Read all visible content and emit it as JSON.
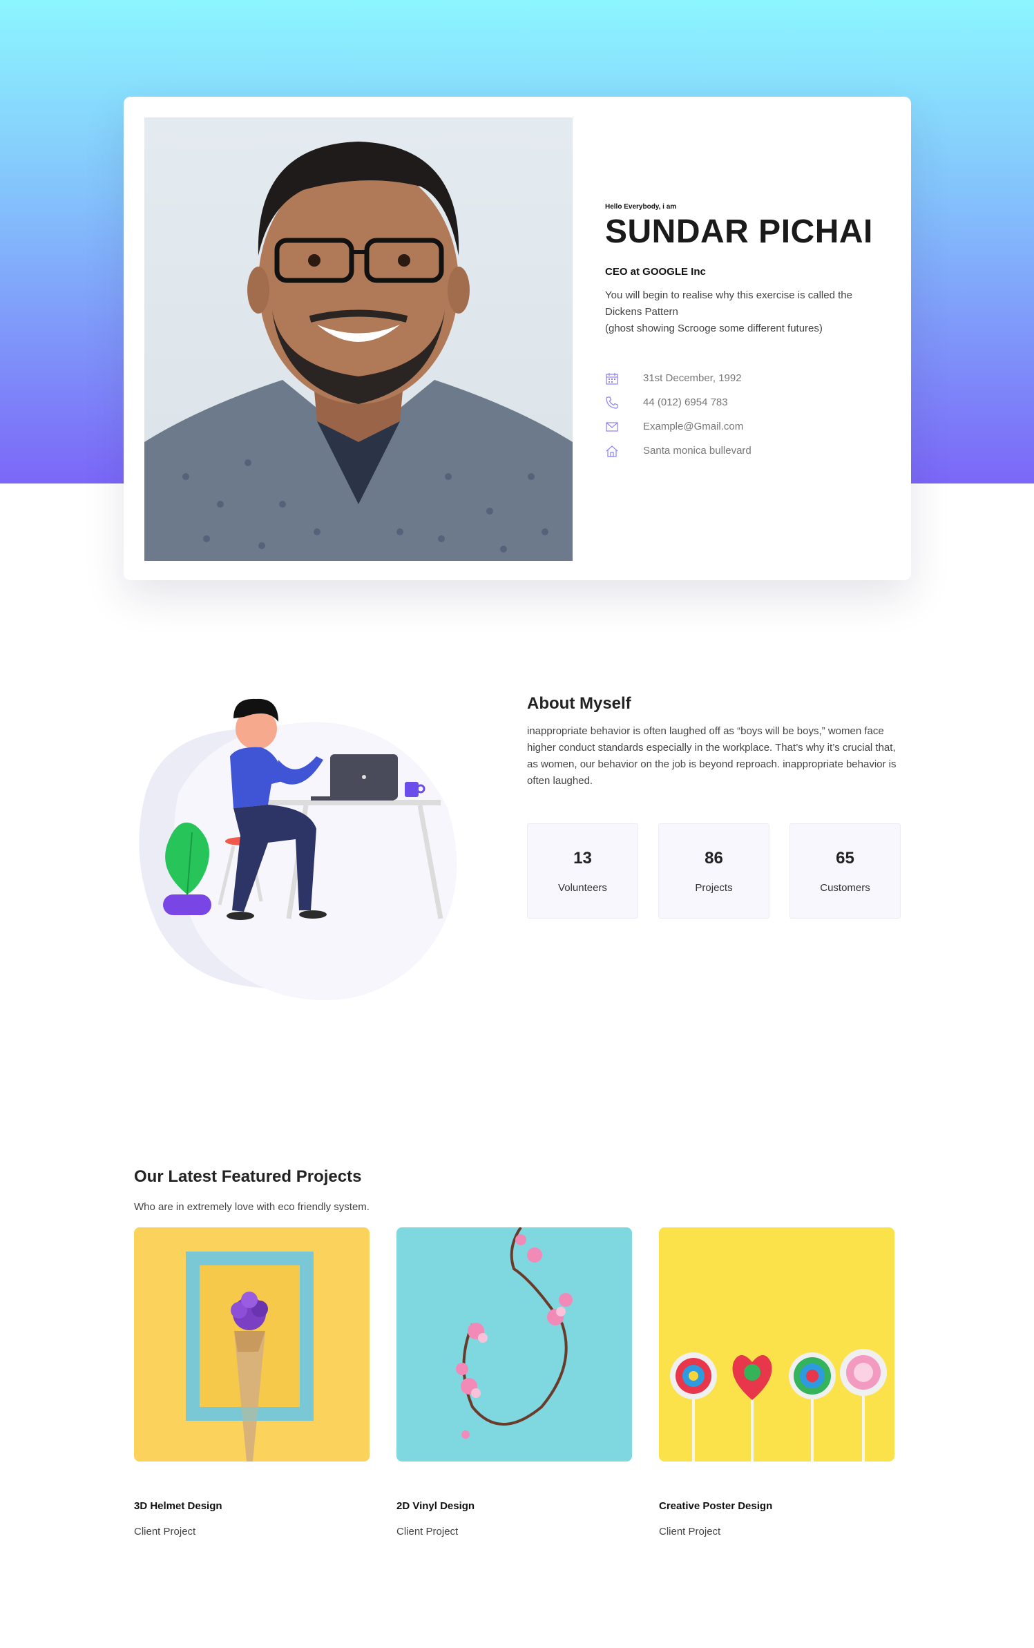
{
  "hero": {
    "greeting": "Hello Everybody, i am",
    "name": "SUNDAR PICHAI",
    "role": "CEO at GOOGLE Inc",
    "bio": "You will begin to realise why this exercise is called the\nDickens Pattern\n(ghost showing Scrooge some different futures)",
    "contacts": [
      {
        "icon": "calendar-icon",
        "text": "31st December, 1992"
      },
      {
        "icon": "phone-icon",
        "text": "44 (012) 6954 783"
      },
      {
        "icon": "mail-icon",
        "text": "Example@Gmail.com"
      },
      {
        "icon": "home-icon",
        "text": "Santa monica bullevard"
      }
    ]
  },
  "about": {
    "title": "About Myself",
    "text": "inappropriate behavior is often laughed off as “boys will be boys,” women face higher conduct standards especially in the workplace. That’s why it’s crucial that, as women, our behavior on the job is beyond reproach. inappropriate behavior is often laughed.",
    "stats": [
      {
        "value": "13",
        "label": "Volunteers"
      },
      {
        "value": "86",
        "label": "Projects"
      },
      {
        "value": "65",
        "label": "Customers"
      }
    ]
  },
  "projects": {
    "title": "Our Latest Featured Projects",
    "subtitle": "Who are in extremely love with eco friendly system.",
    "items": [
      {
        "title": "3D Helmet Design",
        "type": "Client Project"
      },
      {
        "title": "2D Vinyl Design",
        "type": "Client Project"
      },
      {
        "title": "Creative Poster Design",
        "type": "Client Project"
      }
    ]
  },
  "colors": {
    "hero_gradient_top": "#8cf6fe",
    "hero_gradient_bottom": "#7b67f8",
    "icon_accent": "#8a7ff5"
  }
}
